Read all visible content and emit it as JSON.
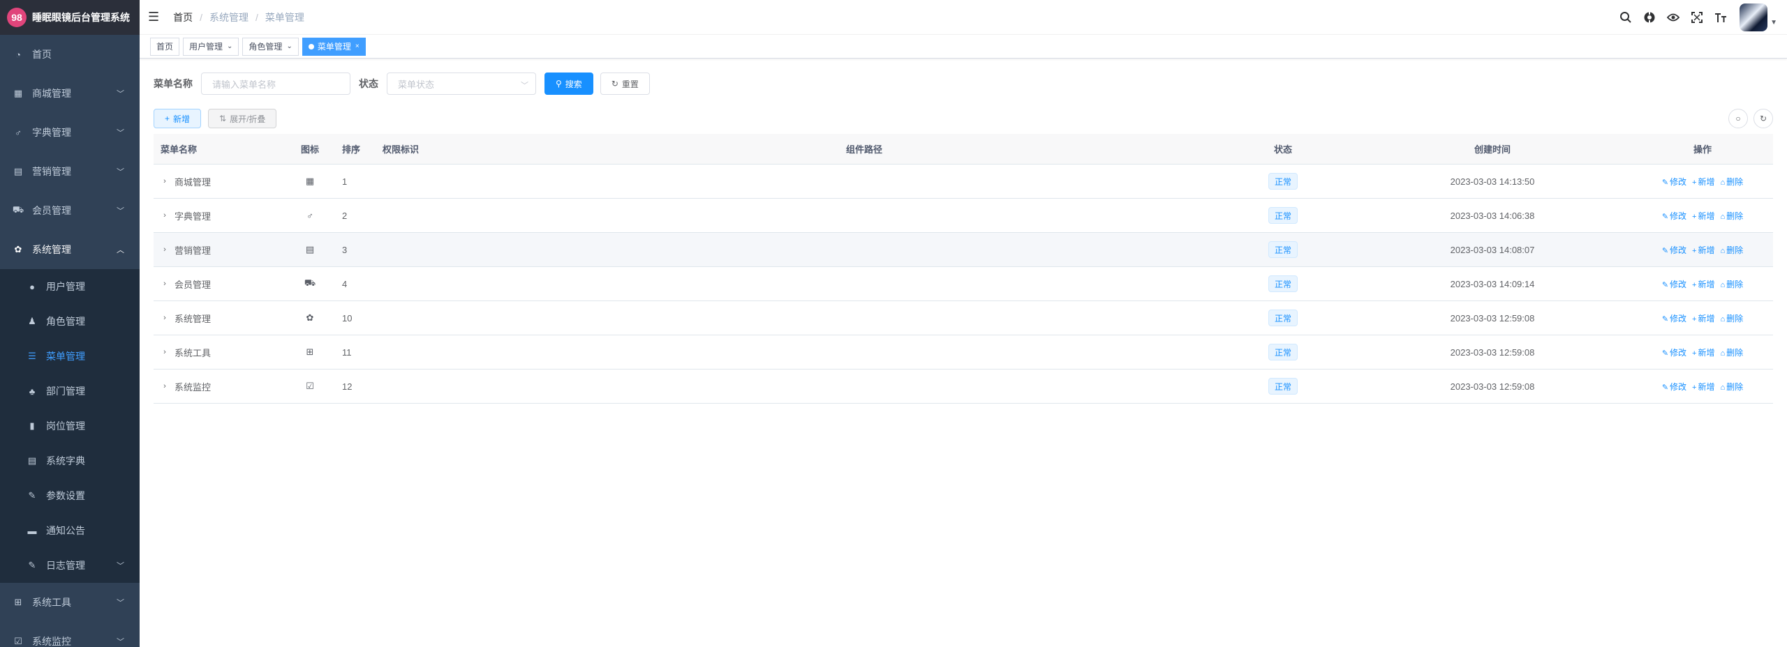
{
  "app": {
    "logo_text": "睡眠眼镜后台管理系统",
    "logo_mark": "98"
  },
  "sidebar": {
    "items": [
      {
        "label": "首页",
        "icon": "dashboard-icon",
        "glyph": "◔",
        "arrow": false
      },
      {
        "label": "商城管理",
        "icon": "grid-icon",
        "glyph": "▦",
        "arrow": true
      },
      {
        "label": "字典管理",
        "icon": "thumb-icon",
        "glyph": "♂",
        "arrow": true
      },
      {
        "label": "营销管理",
        "icon": "document-icon",
        "glyph": "▤",
        "arrow": true
      },
      {
        "label": "会员管理",
        "icon": "bus-icon",
        "glyph": "⛟",
        "arrow": true
      },
      {
        "label": "系统管理",
        "icon": "gear-icon",
        "glyph": "✿",
        "arrow": true,
        "open": true
      }
    ],
    "sub_items": [
      {
        "label": "用户管理",
        "icon": "user-icon",
        "glyph": "●"
      },
      {
        "label": "角色管理",
        "icon": "people-icon",
        "glyph": "♟"
      },
      {
        "label": "菜单管理",
        "icon": "tree-table-icon",
        "glyph": "☰",
        "active": true
      },
      {
        "label": "部门管理",
        "icon": "tree-icon",
        "glyph": "♣"
      },
      {
        "label": "岗位管理",
        "icon": "post-icon",
        "glyph": "▮"
      },
      {
        "label": "系统字典",
        "icon": "dict-icon",
        "glyph": "▤"
      },
      {
        "label": "参数设置",
        "icon": "edit-icon",
        "glyph": "✎"
      },
      {
        "label": "通知公告",
        "icon": "message-icon",
        "glyph": "▬"
      },
      {
        "label": "日志管理",
        "icon": "log-icon",
        "glyph": "✎",
        "arrow": true
      }
    ],
    "bottom_items": [
      {
        "label": "系统工具",
        "icon": "tool-icon",
        "glyph": "⊞",
        "arrow": true
      },
      {
        "label": "系统监控",
        "icon": "monitor-icon",
        "glyph": "☑",
        "arrow": true
      }
    ]
  },
  "navbar": {
    "breadcrumb": [
      "首页",
      "系统管理",
      "菜单管理"
    ]
  },
  "tags": [
    {
      "label": "首页",
      "closable": false
    },
    {
      "label": "用户管理",
      "closable": true
    },
    {
      "label": "角色管理",
      "closable": true
    },
    {
      "label": "菜单管理",
      "closable": true,
      "active": true
    }
  ],
  "search": {
    "name_label": "菜单名称",
    "name_placeholder": "请输入菜单名称",
    "status_label": "状态",
    "status_placeholder": "菜单状态",
    "search_btn": "搜索",
    "reset_btn": "重置"
  },
  "actions": {
    "add_btn": "新增",
    "expand_btn": "展开/折叠"
  },
  "table": {
    "headers": {
      "name": "菜单名称",
      "icon": "图标",
      "order": "排序",
      "perm": "权限标识",
      "path": "组件路径",
      "status": "状态",
      "time": "创建时间",
      "ops": "操作"
    },
    "ops": {
      "edit": "修改",
      "add": "新增",
      "delete": "删除"
    },
    "rows": [
      {
        "name": "商城管理",
        "icon": "grid-icon",
        "glyph": "▦",
        "order": "1",
        "perm": "",
        "path": "",
        "status": "正常",
        "time": "2023-03-03 14:13:50"
      },
      {
        "name": "字典管理",
        "icon": "thumb-icon",
        "glyph": "♂",
        "order": "2",
        "perm": "",
        "path": "",
        "status": "正常",
        "time": "2023-03-03 14:06:38"
      },
      {
        "name": "营销管理",
        "icon": "document-icon",
        "glyph": "▤",
        "order": "3",
        "perm": "",
        "path": "",
        "status": "正常",
        "time": "2023-03-03 14:08:07"
      },
      {
        "name": "会员管理",
        "icon": "bus-icon",
        "glyph": "⛟",
        "order": "4",
        "perm": "",
        "path": "",
        "status": "正常",
        "time": "2023-03-03 14:09:14"
      },
      {
        "name": "系统管理",
        "icon": "gear-icon",
        "glyph": "✿",
        "order": "10",
        "perm": "",
        "path": "",
        "status": "正常",
        "time": "2023-03-03 12:59:08"
      },
      {
        "name": "系统工具",
        "icon": "tool-icon",
        "glyph": "⊞",
        "order": "11",
        "perm": "",
        "path": "",
        "status": "正常",
        "time": "2023-03-03 12:59:08"
      },
      {
        "name": "系统监控",
        "icon": "monitor-icon",
        "glyph": "☑",
        "order": "12",
        "perm": "",
        "path": "",
        "status": "正常",
        "time": "2023-03-03 12:59:08"
      }
    ]
  },
  "colors": {
    "sidebar_bg": "#304156",
    "submenu_bg": "#1f2d3d",
    "primary": "#1890ff",
    "active_menu": "#409eff"
  }
}
